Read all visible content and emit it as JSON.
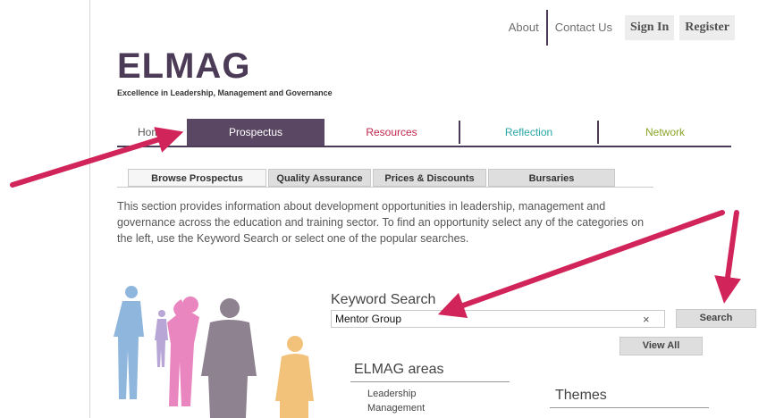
{
  "header": {
    "links": [
      "About",
      "Contact Us"
    ],
    "sign_in": "Sign In",
    "register": "Register"
  },
  "brand": {
    "logo": "ELMAG",
    "tagline": "Excellence in Leadership, Management and Governance",
    "color": "#4b3b57"
  },
  "nav": {
    "items": [
      {
        "label": "Home",
        "color": "#555555"
      },
      {
        "label": "Prospectus",
        "color": "#ffffff"
      },
      {
        "label": "Resources",
        "color": "#c0264f"
      },
      {
        "label": "Reflection",
        "color": "#2aa6a6"
      },
      {
        "label": "Network",
        "color": "#8aa52a"
      }
    ],
    "active_index": 1
  },
  "subtabs": [
    "Browse Prospectus",
    "Quality Assurance",
    "Prices & Discounts",
    "Bursaries"
  ],
  "intro_text": "This section provides information about development opportunities in leadership, management and governance across the education and training sector. To find an opportunity select any of the categories on the left, use the Keyword Search or select one of the popular searches.",
  "keyword_search": {
    "title": "Keyword Search",
    "value": "Mentor Group",
    "clear_icon": "×",
    "search_button": "Search",
    "view_all_button": "View All"
  },
  "areas": {
    "title": "ELMAG areas",
    "items": [
      "Leadership",
      "Management"
    ]
  },
  "themes": {
    "title": "Themes"
  },
  "annotation_color": "#d1245a"
}
